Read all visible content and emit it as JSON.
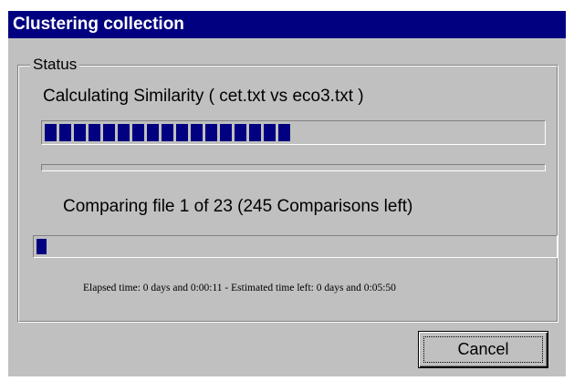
{
  "window": {
    "title": "Clustering collection"
  },
  "status_group": {
    "legend": "Status",
    "similarity_label": "Calculating Similarity ( cet.txt vs eco3.txt )",
    "similarity_progress": 0.5,
    "secondary_progress": 0,
    "comparison_label": "Comparing file 1 of 23 (245 Comparisons left)",
    "comparison_progress": 0.02,
    "time_label": "Elapsed time: 0 days and 0:00:11 - Estimated time left: 0 days and 0:05:50"
  },
  "buttons": {
    "cancel_label": "Cancel"
  },
  "colors": {
    "title_bar": "#000080",
    "progress_fill": "#000080",
    "face": "#c0c0c0"
  }
}
